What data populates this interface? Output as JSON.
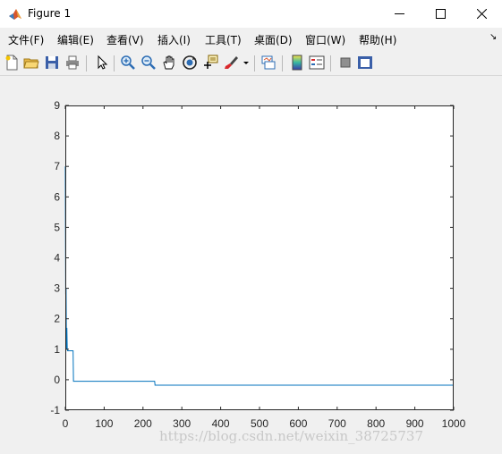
{
  "window": {
    "title": "Figure 1",
    "icon": "matlab-logo-icon",
    "controls": [
      "minimize-icon",
      "maximize-icon",
      "close-icon"
    ]
  },
  "menubar": {
    "items": [
      "文件(F)",
      "编辑(E)",
      "查看(V)",
      "插入(I)",
      "工具(T)",
      "桌面(D)",
      "窗口(W)",
      "帮助(H)"
    ],
    "overflow_icon": "dock-arrow-icon"
  },
  "toolbar": {
    "icons": [
      "new-figure-icon",
      "open-file-icon",
      "save-icon",
      "print-icon",
      "pointer-icon",
      "zoom-in-icon",
      "zoom-out-icon",
      "pan-icon",
      "rotate-3d-icon",
      "data-cursor-icon",
      "brush-icon",
      "link-plot-icon",
      "colorbar-icon",
      "legend-icon",
      "hide-plot-tools-icon",
      "show-plot-tools-icon"
    ]
  },
  "colors": {
    "line": "#0072bd",
    "axes_background": "#ffffff",
    "figure_background": "#f0f0f0"
  },
  "watermark": "https://blog.csdn.net/weixin_38725737",
  "chart_data": {
    "type": "line",
    "title": "",
    "xlabel": "",
    "ylabel": "",
    "xlim": [
      0,
      1000
    ],
    "ylim": [
      -1,
      9
    ],
    "xticks": [
      0,
      100,
      200,
      300,
      400,
      500,
      600,
      700,
      800,
      900,
      1000
    ],
    "yticks": [
      -1,
      0,
      1,
      2,
      3,
      4,
      5,
      6,
      7,
      8,
      9
    ],
    "grid": false,
    "series": [
      {
        "x": [
          0,
          1,
          2,
          3,
          4,
          5,
          6,
          7,
          20,
          21,
          22,
          230,
          231,
          1000
        ],
        "y": [
          7.0,
          2.8,
          3.0,
          1.0,
          1.7,
          1.0,
          0.95,
          0.95,
          0.95,
          -0.05,
          -0.05,
          -0.05,
          -0.18,
          -0.18
        ]
      }
    ]
  }
}
